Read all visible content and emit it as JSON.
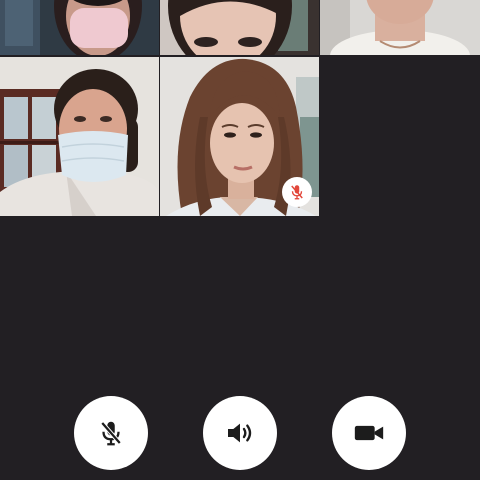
{
  "call": {
    "participants": [
      {
        "id": "p1",
        "video": "on",
        "mask": true
      },
      {
        "id": "p2",
        "video": "on",
        "mask": false
      },
      {
        "id": "p3",
        "video": "on",
        "mask": false
      },
      {
        "id": "p4",
        "video": "on",
        "mask": true
      },
      {
        "id": "p5",
        "video": "on",
        "mask": false,
        "muted": true
      }
    ]
  },
  "controls": {
    "mic": {
      "icon": "mic-off-icon",
      "state": "muted"
    },
    "speaker": {
      "icon": "speaker-icon",
      "state": "on"
    },
    "camera": {
      "icon": "video-camera-icon",
      "state": "on"
    }
  },
  "colors": {
    "background": "#221f23",
    "button": "#ffffff",
    "icon": "#1c1c1c",
    "muted_indicator": "#e2473b"
  }
}
